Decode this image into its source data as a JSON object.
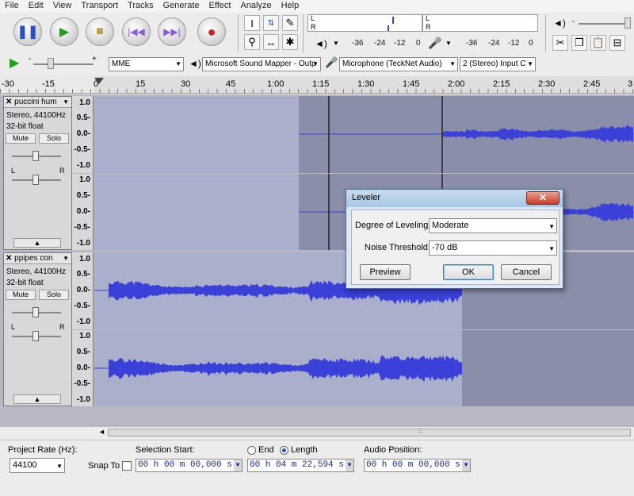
{
  "menu": [
    "File",
    "Edit",
    "View",
    "Transport",
    "Tracks",
    "Generate",
    "Effect",
    "Analyze",
    "Help"
  ],
  "meters": {
    "rec_scale": [
      "-36",
      "-24",
      "-12",
      "0"
    ],
    "play_scale": [
      "-36",
      "-24",
      "-12",
      "0"
    ],
    "lr": [
      "L",
      "R"
    ]
  },
  "device": {
    "host": "MME",
    "output": "Microsoft Sound Mapper - Outp",
    "input": "Microphone (TeckNet Audio)",
    "channels": "2 (Stereo) Input C"
  },
  "slider_marks": {
    "minus": "-",
    "plus": "+"
  },
  "ruler": {
    "ticks": [
      "-30",
      "-15",
      "0",
      "15",
      "30",
      "45",
      "1:00",
      "1:15",
      "1:30",
      "1:45",
      "2:00",
      "2:15",
      "2:30",
      "2:45",
      "3"
    ]
  },
  "tracks": [
    {
      "name": "puccini hum",
      "info1": "Stereo, 44100Hz",
      "info2": "32-bit float",
      "mute": "Mute",
      "solo": "Solo",
      "pan_l": "L",
      "pan_r": "R",
      "scale": [
        "1.0",
        "0.5-",
        "0.0-",
        "-0.5-",
        "-1.0"
      ]
    },
    {
      "name": "ppipes con",
      "info1": "Stereo, 44100Hz",
      "info2": "32-bit float",
      "mute": "Mute",
      "solo": "Solo",
      "pan_l": "L",
      "pan_r": "R",
      "scale": [
        "1.0",
        "0.5-",
        "0.0-",
        "-0.5-",
        "-1.0"
      ]
    }
  ],
  "dialog": {
    "title": "Leveler",
    "degree_label": "Degree of Leveling:",
    "degree_value": "Moderate",
    "noise_label": "Noise Threshold:",
    "noise_value": "-70 dB",
    "preview": "Preview",
    "ok": "OK",
    "cancel": "Cancel"
  },
  "selection": {
    "rate_label": "Project Rate (Hz):",
    "rate_value": "44100",
    "snap_label": "Snap To",
    "start_label": "Selection Start:",
    "end_label": "End",
    "length_label": "Length",
    "audio_pos_label": "Audio Position:",
    "start_value": "00 h 00 m 00,000 s",
    "length_value": "00 h 04 m 22,594 s",
    "audio_pos_value": "00 h 00 m 00,000 s",
    "length_selected": true
  },
  "colors": {
    "wave": "#3a40d8",
    "wave_bg": "#aab0cc",
    "selected_bg": "#8a8ea8",
    "panel": "#d8d8d8"
  }
}
